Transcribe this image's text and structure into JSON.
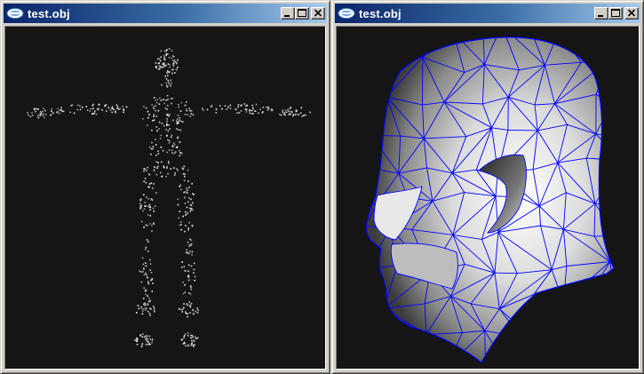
{
  "windows": [
    {
      "title": "test.obj",
      "view": "point-cloud",
      "icons": [
        "app-icon",
        "minimize-icon",
        "maximize-icon",
        "close-icon"
      ]
    },
    {
      "title": "test.obj",
      "view": "shaded-wireframe",
      "icons": [
        "app-icon",
        "minimize-icon",
        "maximize-icon",
        "close-icon"
      ]
    }
  ],
  "colors": {
    "title_gradient_start": "#0a246a",
    "title_gradient_end": "#a6caf0",
    "viewport_background": "#151515",
    "wireframe": "#0000ff",
    "points": "#ffffff"
  }
}
